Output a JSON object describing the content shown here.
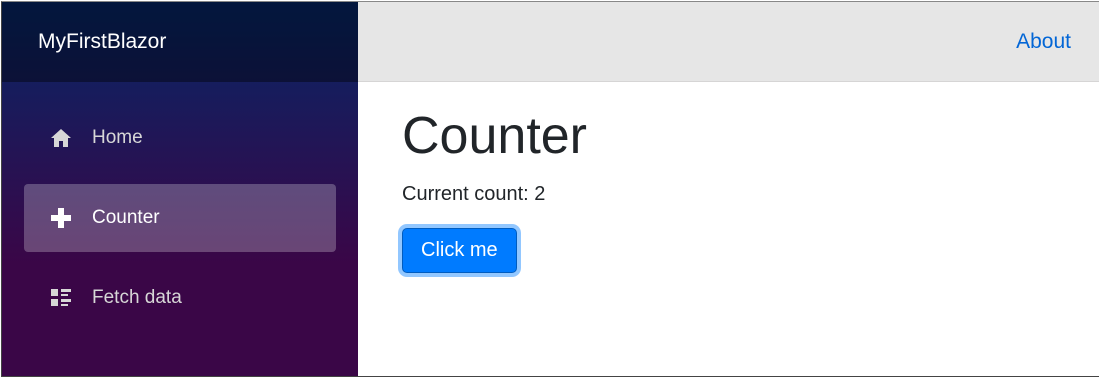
{
  "sidebar": {
    "brand": "MyFirstBlazor",
    "items": [
      {
        "label": "Home",
        "icon": "home-icon",
        "active": false
      },
      {
        "label": "Counter",
        "icon": "plus-icon",
        "active": true
      },
      {
        "label": "Fetch data",
        "icon": "list-rich-icon",
        "active": false
      }
    ]
  },
  "header": {
    "about_label": "About"
  },
  "main": {
    "title": "Counter",
    "count_text": "Current count: 2",
    "button_label": "Click me"
  },
  "colors": {
    "sidebar_top": "#052767",
    "sidebar_bottom": "#3a0647",
    "link": "#0366d6",
    "button": "#007bff"
  }
}
